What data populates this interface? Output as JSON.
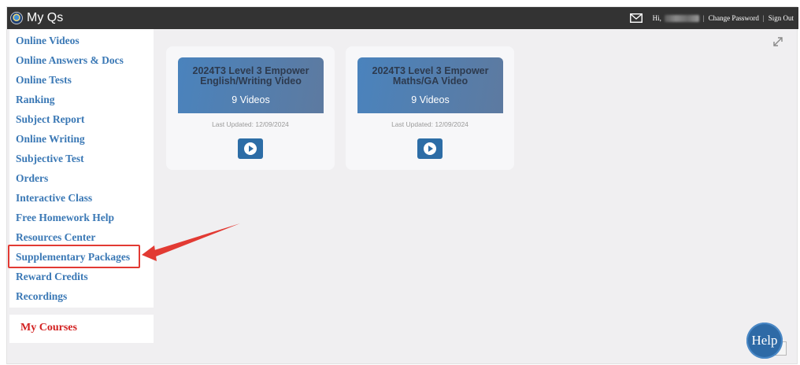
{
  "header": {
    "app_title": "My Qs",
    "greeting": "Hi, ",
    "change_password": "Change Password",
    "sign_out": "Sign Out",
    "separator": "|"
  },
  "sidebar": {
    "items": [
      {
        "label": "Online Videos"
      },
      {
        "label": "Online Answers & Docs"
      },
      {
        "label": "Online Tests"
      },
      {
        "label": "Ranking"
      },
      {
        "label": "Subject Report"
      },
      {
        "label": "Online Writing"
      },
      {
        "label": "Subjective Test"
      },
      {
        "label": "Orders"
      },
      {
        "label": "Interactive Class"
      },
      {
        "label": "Free Homework Help"
      },
      {
        "label": "Resources Center"
      },
      {
        "label": "Supplementary Packages"
      },
      {
        "label": "Reward Credits"
      },
      {
        "label": "Recordings"
      }
    ],
    "my_courses": "My Courses"
  },
  "cards": [
    {
      "title_line1": "2024T3 Level 3 Empower",
      "title_line2": "English/Writing Video",
      "count": "9 Videos",
      "updated": "Last Updated: 12/09/2024"
    },
    {
      "title_line1": "2024T3 Level 3 Empower",
      "title_line2": "Maths/GA Video",
      "count": "9 Videos",
      "updated": "Last Updated: 12/09/2024"
    }
  ],
  "help": {
    "label": "Help"
  },
  "icons": {
    "logo": "logo-icon",
    "mail": "mail-icon",
    "expand": "expand-icon",
    "play": "play-icon"
  },
  "colors": {
    "topbar": "#333333",
    "nav_link": "#3a78b5",
    "my_courses": "#d21f1f",
    "annotation": "#e23a33",
    "card_header": "#4a83bd",
    "play_button": "#2d6da6",
    "help_button": "#2e6aa6"
  }
}
